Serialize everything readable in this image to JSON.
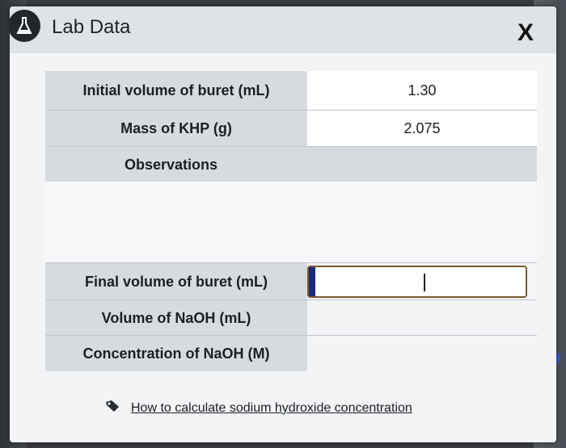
{
  "window": {
    "title": "Lab Data",
    "close_label": "X"
  },
  "table": {
    "rows": [
      {
        "label": "Initial volume of buret (mL)",
        "value": "1.30"
      },
      {
        "label": "Mass of KHP (g)",
        "value": "2.075"
      },
      {
        "label": "Observations",
        "value": ""
      },
      {
        "label": "Final volume of buret (mL)",
        "value": ""
      },
      {
        "label": "Volume of NaOH (mL)",
        "value": ""
      },
      {
        "label": "Concentration of NaOH (M)",
        "value": ""
      }
    ]
  },
  "help": {
    "link_text": "How to calculate sodium hydroxide concentration"
  }
}
